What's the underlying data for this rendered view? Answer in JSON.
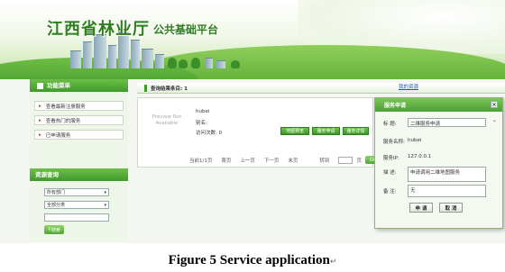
{
  "header": {
    "title": "江西省林业厅",
    "subtitle": "公共基础平台"
  },
  "sidebar": {
    "heading": "功能菜单",
    "items": [
      {
        "label": "查看最新注册服务"
      },
      {
        "label": "查看热门的服务"
      },
      {
        "label": "已申请服务"
      }
    ],
    "search_heading": "资源查询",
    "department_select": "所有部门",
    "category_select": "全部分类",
    "search_button": "搜索"
  },
  "main": {
    "heading": "查询结果条目: 1",
    "my_services_link": "我的资源",
    "result": {
      "thumbnail_text": "Preview Not Available",
      "name": "hubei",
      "alias": "别名:",
      "visits": "访问次数: 0",
      "buttons": [
        "地图预览",
        "服务申请",
        "服务详情"
      ]
    },
    "pager": {
      "info": "当前1/1页",
      "first": "首页",
      "prev": "上一页",
      "next": "下一页",
      "last": "末页",
      "goto": "转到",
      "page_unit": "页",
      "go_button": "GO"
    }
  },
  "dialog": {
    "title": "服务申请",
    "close": "×",
    "title_label": "标 题:",
    "title_value": "二维服务申请",
    "name_label": "服务名称:",
    "name_value": "hubei",
    "ip_label": "服务IP:",
    "ip_value": "127.0.0.1",
    "desc_label": "描 述:",
    "desc_value": "申请调用二维地图服务",
    "note_label": "备 注:",
    "note_value": "无",
    "required_mark": "*",
    "submit": "申 请",
    "cancel": "取 消"
  },
  "caption": {
    "text": "Figure 5 Service application",
    "mark": "↵"
  }
}
